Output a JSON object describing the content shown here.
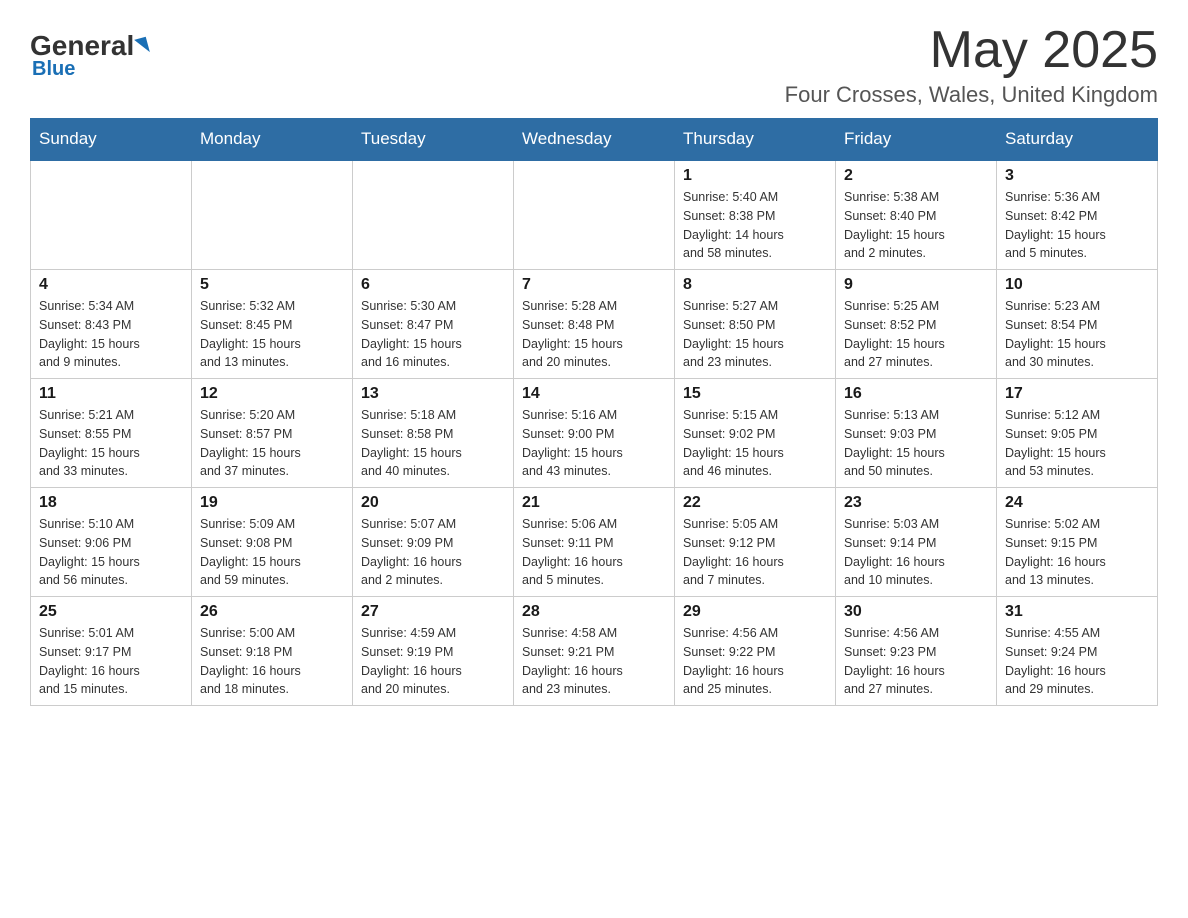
{
  "header": {
    "logo": {
      "general": "General",
      "blue": "Blue"
    },
    "month_title": "May 2025",
    "location": "Four Crosses, Wales, United Kingdom"
  },
  "days_of_week": [
    "Sunday",
    "Monday",
    "Tuesday",
    "Wednesday",
    "Thursday",
    "Friday",
    "Saturday"
  ],
  "weeks": [
    [
      {
        "day": "",
        "info": ""
      },
      {
        "day": "",
        "info": ""
      },
      {
        "day": "",
        "info": ""
      },
      {
        "day": "",
        "info": ""
      },
      {
        "day": "1",
        "info": "Sunrise: 5:40 AM\nSunset: 8:38 PM\nDaylight: 14 hours\nand 58 minutes."
      },
      {
        "day": "2",
        "info": "Sunrise: 5:38 AM\nSunset: 8:40 PM\nDaylight: 15 hours\nand 2 minutes."
      },
      {
        "day": "3",
        "info": "Sunrise: 5:36 AM\nSunset: 8:42 PM\nDaylight: 15 hours\nand 5 minutes."
      }
    ],
    [
      {
        "day": "4",
        "info": "Sunrise: 5:34 AM\nSunset: 8:43 PM\nDaylight: 15 hours\nand 9 minutes."
      },
      {
        "day": "5",
        "info": "Sunrise: 5:32 AM\nSunset: 8:45 PM\nDaylight: 15 hours\nand 13 minutes."
      },
      {
        "day": "6",
        "info": "Sunrise: 5:30 AM\nSunset: 8:47 PM\nDaylight: 15 hours\nand 16 minutes."
      },
      {
        "day": "7",
        "info": "Sunrise: 5:28 AM\nSunset: 8:48 PM\nDaylight: 15 hours\nand 20 minutes."
      },
      {
        "day": "8",
        "info": "Sunrise: 5:27 AM\nSunset: 8:50 PM\nDaylight: 15 hours\nand 23 minutes."
      },
      {
        "day": "9",
        "info": "Sunrise: 5:25 AM\nSunset: 8:52 PM\nDaylight: 15 hours\nand 27 minutes."
      },
      {
        "day": "10",
        "info": "Sunrise: 5:23 AM\nSunset: 8:54 PM\nDaylight: 15 hours\nand 30 minutes."
      }
    ],
    [
      {
        "day": "11",
        "info": "Sunrise: 5:21 AM\nSunset: 8:55 PM\nDaylight: 15 hours\nand 33 minutes."
      },
      {
        "day": "12",
        "info": "Sunrise: 5:20 AM\nSunset: 8:57 PM\nDaylight: 15 hours\nand 37 minutes."
      },
      {
        "day": "13",
        "info": "Sunrise: 5:18 AM\nSunset: 8:58 PM\nDaylight: 15 hours\nand 40 minutes."
      },
      {
        "day": "14",
        "info": "Sunrise: 5:16 AM\nSunset: 9:00 PM\nDaylight: 15 hours\nand 43 minutes."
      },
      {
        "day": "15",
        "info": "Sunrise: 5:15 AM\nSunset: 9:02 PM\nDaylight: 15 hours\nand 46 minutes."
      },
      {
        "day": "16",
        "info": "Sunrise: 5:13 AM\nSunset: 9:03 PM\nDaylight: 15 hours\nand 50 minutes."
      },
      {
        "day": "17",
        "info": "Sunrise: 5:12 AM\nSunset: 9:05 PM\nDaylight: 15 hours\nand 53 minutes."
      }
    ],
    [
      {
        "day": "18",
        "info": "Sunrise: 5:10 AM\nSunset: 9:06 PM\nDaylight: 15 hours\nand 56 minutes."
      },
      {
        "day": "19",
        "info": "Sunrise: 5:09 AM\nSunset: 9:08 PM\nDaylight: 15 hours\nand 59 minutes."
      },
      {
        "day": "20",
        "info": "Sunrise: 5:07 AM\nSunset: 9:09 PM\nDaylight: 16 hours\nand 2 minutes."
      },
      {
        "day": "21",
        "info": "Sunrise: 5:06 AM\nSunset: 9:11 PM\nDaylight: 16 hours\nand 5 minutes."
      },
      {
        "day": "22",
        "info": "Sunrise: 5:05 AM\nSunset: 9:12 PM\nDaylight: 16 hours\nand 7 minutes."
      },
      {
        "day": "23",
        "info": "Sunrise: 5:03 AM\nSunset: 9:14 PM\nDaylight: 16 hours\nand 10 minutes."
      },
      {
        "day": "24",
        "info": "Sunrise: 5:02 AM\nSunset: 9:15 PM\nDaylight: 16 hours\nand 13 minutes."
      }
    ],
    [
      {
        "day": "25",
        "info": "Sunrise: 5:01 AM\nSunset: 9:17 PM\nDaylight: 16 hours\nand 15 minutes."
      },
      {
        "day": "26",
        "info": "Sunrise: 5:00 AM\nSunset: 9:18 PM\nDaylight: 16 hours\nand 18 minutes."
      },
      {
        "day": "27",
        "info": "Sunrise: 4:59 AM\nSunset: 9:19 PM\nDaylight: 16 hours\nand 20 minutes."
      },
      {
        "day": "28",
        "info": "Sunrise: 4:58 AM\nSunset: 9:21 PM\nDaylight: 16 hours\nand 23 minutes."
      },
      {
        "day": "29",
        "info": "Sunrise: 4:56 AM\nSunset: 9:22 PM\nDaylight: 16 hours\nand 25 minutes."
      },
      {
        "day": "30",
        "info": "Sunrise: 4:56 AM\nSunset: 9:23 PM\nDaylight: 16 hours\nand 27 minutes."
      },
      {
        "day": "31",
        "info": "Sunrise: 4:55 AM\nSunset: 9:24 PM\nDaylight: 16 hours\nand 29 minutes."
      }
    ]
  ]
}
